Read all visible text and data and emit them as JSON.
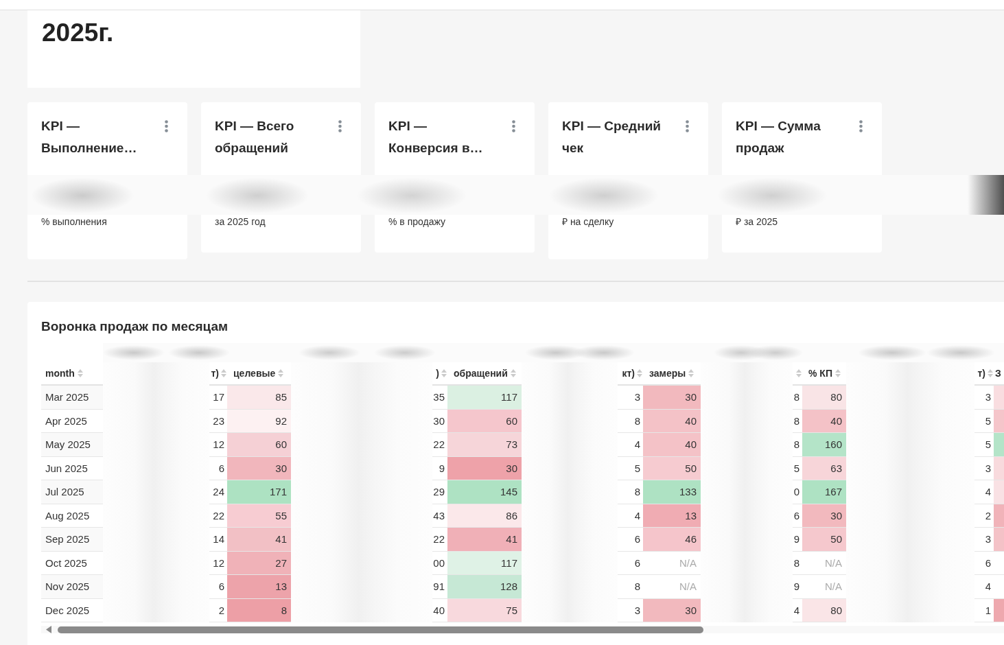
{
  "header": {
    "title": "2025г."
  },
  "kpi_cards": [
    {
      "title": "KPI — Выполнение…",
      "caption": "% выполнения"
    },
    {
      "title": "KPI — Всего обращений",
      "caption": "за 2025 год"
    },
    {
      "title": "KPI — Конверсия в…",
      "caption": "% в продажу"
    },
    {
      "title": "KPI — Средний чек",
      "caption": "₽ на сделку"
    },
    {
      "title": "KPI — Сумма продаж",
      "caption": "₽ за 2025"
    }
  ],
  "funnel_table": {
    "title": "Воронка продаж по месяцам",
    "columns": [
      {
        "kind": "label",
        "label": "month",
        "sortable": true
      },
      {
        "kind": "number",
        "label": "т)",
        "sortable": true
      },
      {
        "kind": "heat",
        "label": "целевые",
        "sortable": true
      },
      {
        "kind": "number",
        "label": ")",
        "sortable": true
      },
      {
        "kind": "heat",
        "label": "обращений",
        "sortable": true
      },
      {
        "kind": "number",
        "label": "кт)",
        "sortable": true
      },
      {
        "kind": "heat",
        "label": "замеры",
        "sortable": true
      },
      {
        "kind": "number",
        "sortable": true
      },
      {
        "kind": "heat",
        "label": "% КП",
        "sortable": true
      },
      {
        "kind": "number",
        "label": "т)",
        "sortable": true
      },
      {
        "kind": "heat",
        "label": "З",
        "sortable": false
      }
    ],
    "rows": [
      {
        "cells": [
          {
            "text": "Mar 2025"
          },
          {
            "text": "17"
          },
          {
            "text": "85",
            "color": "#fae8ea"
          },
          {
            "text": "35"
          },
          {
            "text": "117",
            "color": "#dbf0e2"
          },
          {
            "text": "3"
          },
          {
            "text": "30",
            "color": "#f2b9be"
          },
          {
            "text": "8"
          },
          {
            "text": "80",
            "color": "#f9e4e6"
          },
          {
            "text": "3"
          },
          {
            "color": "#f9dde0"
          }
        ]
      },
      {
        "cells": [
          {
            "text": "Apr 2025"
          },
          {
            "text": "23"
          },
          {
            "text": "92",
            "color": "#fdf1f2"
          },
          {
            "text": "30"
          },
          {
            "text": "60",
            "color": "#f5c6cc"
          },
          {
            "text": "8"
          },
          {
            "text": "40",
            "color": "#f4c2c7"
          },
          {
            "text": "8"
          },
          {
            "text": "40",
            "color": "#f4c2c7"
          },
          {
            "text": "5"
          },
          {
            "color": "#f5c5ca"
          }
        ]
      },
      {
        "cells": [
          {
            "text": "May 2025"
          },
          {
            "text": "12"
          },
          {
            "text": "60",
            "color": "#f5d0d5"
          },
          {
            "text": "22"
          },
          {
            "text": "73",
            "color": "#f6d5d9"
          },
          {
            "text": "4"
          },
          {
            "text": "40",
            "color": "#f4c2c7"
          },
          {
            "text": "8"
          },
          {
            "text": "160",
            "color": "#b4e4c8"
          },
          {
            "text": "5"
          },
          {
            "color": "#b4e4c8"
          }
        ]
      },
      {
        "cells": [
          {
            "text": "Jun 2025"
          },
          {
            "text": "6"
          },
          {
            "text": "30",
            "color": "#f1b6bc"
          },
          {
            "text": "9"
          },
          {
            "text": "30",
            "color": "#eea2a9"
          },
          {
            "text": "5"
          },
          {
            "text": "50",
            "color": "#f6cbd0"
          },
          {
            "text": "5"
          },
          {
            "text": "63",
            "color": "#f7d5d9"
          },
          {
            "text": "3"
          },
          {
            "color": "#f8dadd"
          }
        ]
      },
      {
        "cells": [
          {
            "text": "Jul 2025"
          },
          {
            "text": "24"
          },
          {
            "text": "171",
            "color": "#ade2c2"
          },
          {
            "text": "29"
          },
          {
            "text": "145",
            "color": "#aee2c3"
          },
          {
            "text": "8"
          },
          {
            "text": "133",
            "color": "#aee2c3"
          },
          {
            "text": "0"
          },
          {
            "text": "167",
            "color": "#aee2c3"
          },
          {
            "text": "4"
          },
          {
            "color": "#f9e1e4"
          }
        ]
      },
      {
        "cells": [
          {
            "text": "Aug 2025"
          },
          {
            "text": "22"
          },
          {
            "text": "55",
            "color": "#f7ccd2"
          },
          {
            "text": "43"
          },
          {
            "text": "86",
            "color": "#fbe8ea"
          },
          {
            "text": "4"
          },
          {
            "text": "13",
            "color": "#f0acb3"
          },
          {
            "text": "6"
          },
          {
            "text": "30",
            "color": "#f2b9be"
          },
          {
            "text": "2"
          },
          {
            "color": "#f1b3b9"
          }
        ]
      },
      {
        "cells": [
          {
            "text": "Sep 2025"
          },
          {
            "text": "14"
          },
          {
            "text": "41",
            "color": "#f2c0c5"
          },
          {
            "text": "22"
          },
          {
            "text": "41",
            "color": "#f0b0b7"
          },
          {
            "text": "6"
          },
          {
            "text": "46",
            "color": "#f5c5cb"
          },
          {
            "text": "9"
          },
          {
            "text": "50",
            "color": "#f5c8cd"
          },
          {
            "text": "3"
          },
          {
            "color": "#f4c2c7"
          }
        ]
      },
      {
        "cells": [
          {
            "text": "Oct 2025"
          },
          {
            "text": "12"
          },
          {
            "text": "27",
            "color": "#f0b2b8"
          },
          {
            "text": "00"
          },
          {
            "text": "117",
            "color": "#dff2e6"
          },
          {
            "text": "6"
          },
          {
            "text": "N/A"
          },
          {
            "text": "8"
          },
          {
            "text": "N/A"
          },
          {
            "text": "6"
          },
          {}
        ]
      },
      {
        "cells": [
          {
            "text": "Nov 2025"
          },
          {
            "text": "6"
          },
          {
            "text": "13",
            "color": "#eda3aa"
          },
          {
            "text": "91"
          },
          {
            "text": "128",
            "color": "#c6e8d5"
          },
          {
            "text": "8"
          },
          {
            "text": "N/A"
          },
          {
            "text": "9"
          },
          {
            "text": "N/A"
          },
          {
            "text": "4"
          },
          {}
        ]
      },
      {
        "cells": [
          {
            "text": "Dec 2025"
          },
          {
            "text": "2"
          },
          {
            "text": "8",
            "color": "#ed9fa6"
          },
          {
            "text": "40"
          },
          {
            "text": "75",
            "color": "#f8d9dd"
          },
          {
            "text": "3"
          },
          {
            "text": "30",
            "color": "#f2b9be"
          },
          {
            "text": "4"
          },
          {
            "text": "80",
            "color": "#fae5e7"
          },
          {
            "text": "1"
          },
          {
            "color": "#eea8ae"
          }
        ]
      }
    ]
  }
}
